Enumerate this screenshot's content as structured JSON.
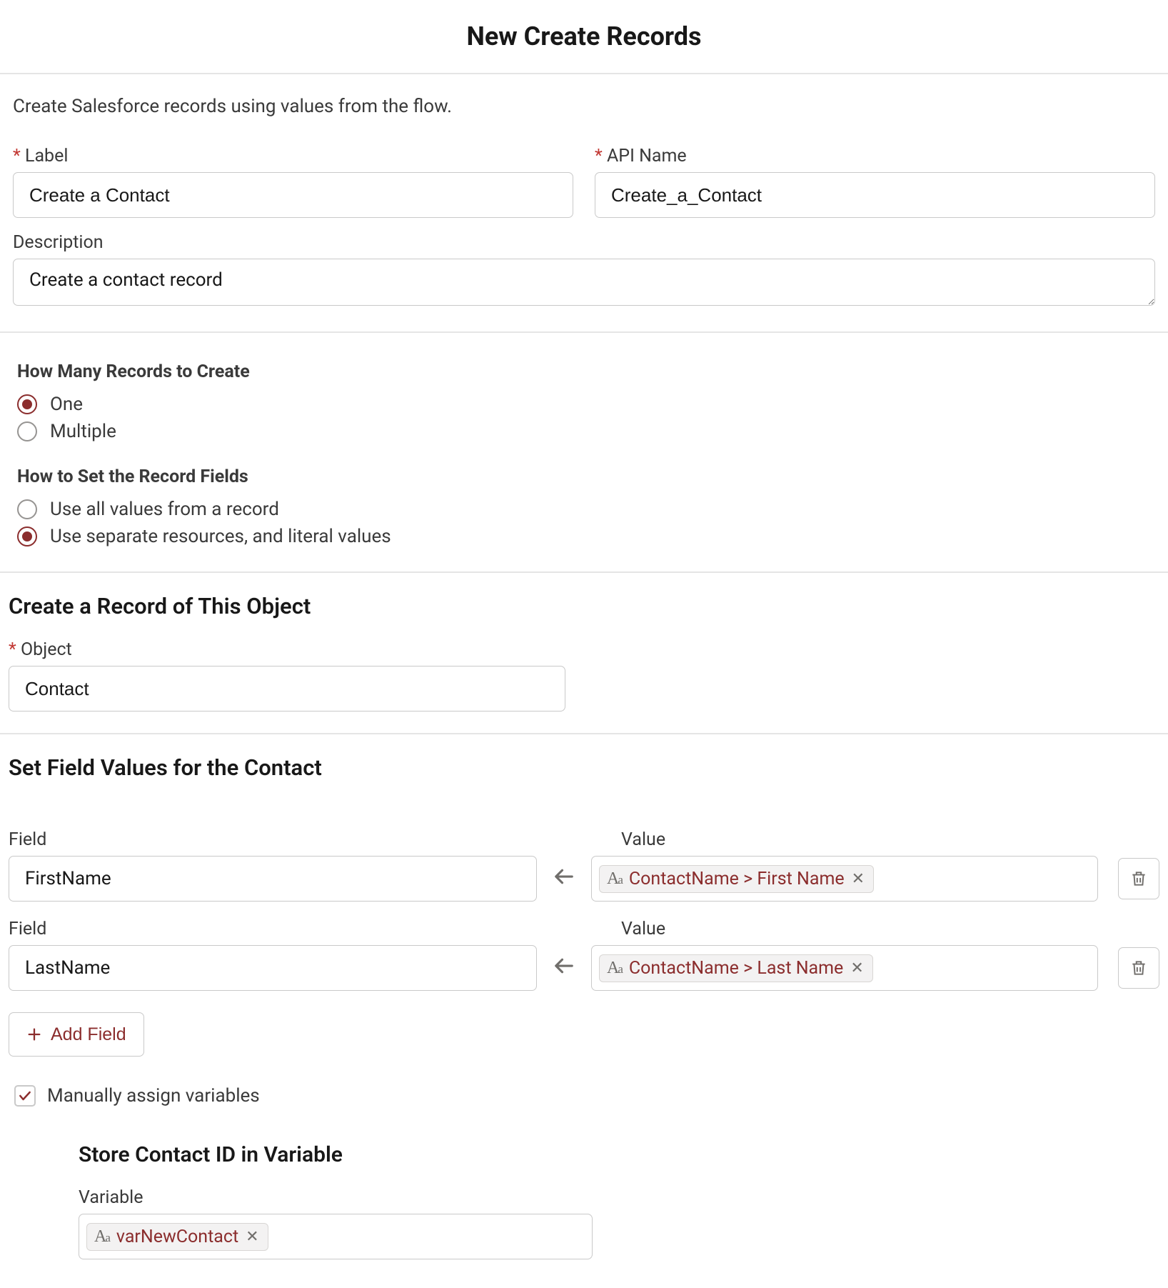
{
  "title": "New Create Records",
  "intro": "Create Salesforce records using values from the flow.",
  "labels": {
    "label": "Label",
    "api_name": "API Name",
    "description": "Description",
    "object": "Object",
    "field": "Field",
    "value": "Value",
    "variable": "Variable"
  },
  "values": {
    "label": "Create a Contact",
    "api_name": "Create_a_Contact",
    "description": "Create a contact record",
    "object": "Contact"
  },
  "questions": {
    "how_many": {
      "heading": "How Many Records to Create",
      "options": [
        "One",
        "Multiple"
      ],
      "selected_index": 0
    },
    "how_set": {
      "heading": "How to Set the Record Fields",
      "options": [
        "Use all values from a record",
        "Use separate resources, and literal values"
      ],
      "selected_index": 1
    }
  },
  "sections": {
    "create_object": "Create a Record of This Object",
    "set_fields": "Set Field Values for the Contact",
    "store_id": "Store Contact ID in Variable"
  },
  "field_pairs": [
    {
      "field": "FirstName",
      "value_pill": "ContactName > First Name"
    },
    {
      "field": "LastName",
      "value_pill": "ContactName > Last Name"
    }
  ],
  "buttons": {
    "add_field": "Add Field"
  },
  "checkbox": {
    "manual_assign": "Manually assign variables",
    "checked": true
  },
  "variable_pill": "varNewContact"
}
